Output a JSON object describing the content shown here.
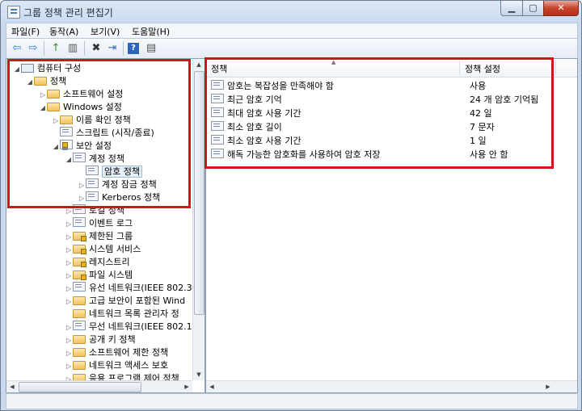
{
  "window": {
    "title": "그룹 정책 관리 편집기",
    "min_glyph": "▁",
    "max_glyph": "▢",
    "close_glyph": "✕"
  },
  "menubar": [
    "파일(F)",
    "동작(A)",
    "보기(V)",
    "도움말(H)"
  ],
  "toolbar": {
    "back": "⇦",
    "forward": "⇨",
    "up": "↑",
    "showhide": "▥",
    "delete": "✖",
    "export": "⇥",
    "help": "?",
    "properties": "▤"
  },
  "tree": [
    "컴퓨터 구성",
    "정책",
    "소프트웨어 설정",
    "Windows 설정",
    "이름 확인 정책",
    "스크립트 (시작/종료)",
    "보안 설정",
    "계정 정책",
    "암호 정책",
    "계정 잠금 정책",
    "Kerberos 정책",
    "로컬 정책",
    "이벤트 로그",
    "제한된 그룹",
    "시스템 서비스",
    "레지스트리",
    "파일 시스템",
    "유선 네트워크(IEEE 802.3",
    "고급 보안이 포함된 Wind",
    "네트워크 목록 관리자 정",
    "무선 네트워크(IEEE 802.1",
    "공개 키 정책",
    "소프트웨어 제한 정책",
    "네트워크 액세스 보호",
    "응용 프로그램 제어 정책"
  ],
  "columns": {
    "policy": "정책",
    "setting": "정책 설정",
    "sort_glyph": "▲"
  },
  "policies": [
    {
      "name": "암호는 복잡성을 만족해야 함",
      "value": "사용"
    },
    {
      "name": "최근 암호 기억",
      "value": "24 개 암호 기억됨"
    },
    {
      "name": "최대 암호 사용 기간",
      "value": "42 일"
    },
    {
      "name": "최소 암호 길이",
      "value": "7 문자"
    },
    {
      "name": "최소 암호 사용 기간",
      "value": "1 일"
    },
    {
      "name": "해독 가능한 암호화를 사용하여 암호 저장",
      "value": "사용 안 함"
    }
  ],
  "highlight_color": "#d0161b"
}
